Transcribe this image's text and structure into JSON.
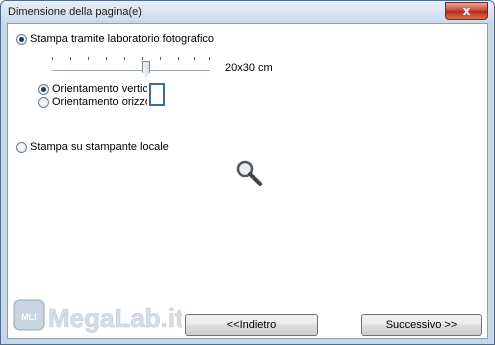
{
  "window": {
    "title": "Dimensione della pagina(e)",
    "close_label": "x"
  },
  "photo_lab": {
    "label": "Stampa tramite laboratorio fotografico",
    "selected": true,
    "size_value": "20x30 cm",
    "orientation_vertical": "Orientamento verticale",
    "orientation_horizontal": "Orientamento orizzontale",
    "orientation_selected": "vertical"
  },
  "local_printer": {
    "label": "Stampa su stampante locale",
    "selected": false
  },
  "buttons": {
    "back": "<<Indietro",
    "next": "Successivo >>"
  },
  "watermark": {
    "text": "MegaLab.it",
    "badge": "MLI"
  }
}
